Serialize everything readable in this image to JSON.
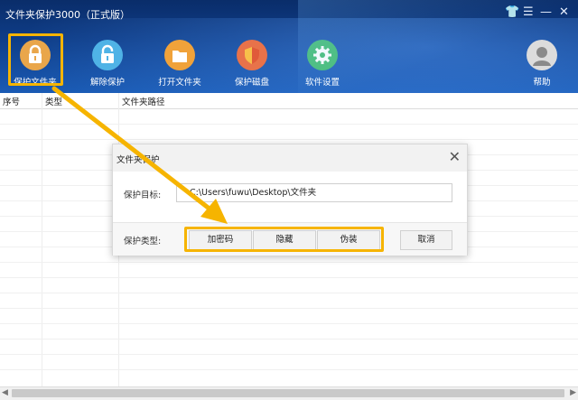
{
  "app": {
    "title": "文件夹保护3000（正式版）"
  },
  "window_controls": {
    "shirt": "👕",
    "menu": "☰",
    "minimize": "—",
    "close": "✕"
  },
  "toolbar": {
    "protect_folder": "保护文件夹",
    "remove_protection": "解除保护",
    "open_folder": "打开文件夹",
    "protect_disk": "保护磁盘",
    "software_settings": "软件设置",
    "help": "帮助"
  },
  "table": {
    "columns": [
      "序号",
      "类型",
      "文件夹路径"
    ]
  },
  "scrollbar": {
    "left": "◀",
    "right": "▶"
  },
  "dialog": {
    "title": "文件夹保护",
    "close": "✕",
    "target_label": "保护目标:",
    "target_path": "C:\\Users\\fuwu\\Desktop\\文件夹",
    "type_label": "保护类型:",
    "buttons": {
      "encrypt": "加密码",
      "hide": "隐藏",
      "disguise": "伪装",
      "cancel": "取消"
    }
  },
  "colors": {
    "highlight": "#f6b400",
    "header_top": "#0a2d6a",
    "header_bottom": "#1a5bb5"
  },
  "icons": {
    "protect_folder": "lock-icon",
    "remove_protection": "unlock-icon",
    "open_folder": "folder-icon",
    "protect_disk": "shield-icon",
    "software_settings": "gear-icon",
    "help": "user-icon"
  }
}
